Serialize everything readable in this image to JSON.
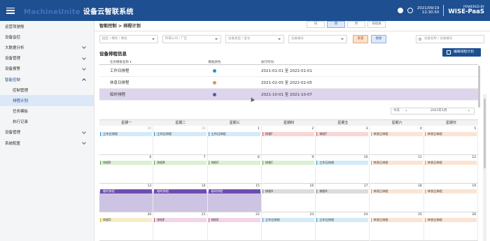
{
  "header": {
    "brand_en": "MachineUnite",
    "brand_cn": "设备云智联系统",
    "date": "2021/09/19",
    "time": "12:30:50",
    "powered_by": "POWERED BY",
    "platform": "WISE-PaaS"
  },
  "sidebar": {
    "items": [
      {
        "label": "运营驾驶舱"
      },
      {
        "label": "设备监控"
      },
      {
        "label": "大数据分析"
      },
      {
        "label": "设备管理"
      },
      {
        "label": "设备报警"
      },
      {
        "label": "智能控制"
      },
      {
        "label": "控制管理"
      },
      {
        "label": "排程计划"
      },
      {
        "label": "任务模板"
      },
      {
        "label": "执行记录"
      },
      {
        "label": "设备管理"
      },
      {
        "label": "系统配置"
      }
    ]
  },
  "breadcrumb": "智能控制 > 排程计划",
  "filters": {
    "area": "园区 / 楼栋 / 楼层",
    "company": "所属公司 / 厂区",
    "type": "设备类型 / 型号",
    "device": "设备编号",
    "reset": "重置",
    "search": "搜索",
    "search_placeholder": "设备名称 / 设备编号"
  },
  "section": {
    "title": "设备排程信息",
    "edit_button": "编辑排程计划"
  },
  "table": {
    "headers": [
      "任务模板名称 ▾",
      "模板颜色",
      "执行时间"
    ],
    "rows": [
      {
        "name": "工作日排程",
        "color": "#2a8fd0",
        "time": "2021-01-01 至 2022-01-01"
      },
      {
        "name": "休息日排程",
        "color": "#e8914f",
        "time": "2021-02-05 至 2022-02-05"
      },
      {
        "name": "临时排程",
        "color": "#6c4eb0",
        "time": "2021-10-01 至 2021-10-07"
      }
    ]
  },
  "views": {
    "day": "日",
    "week": "周",
    "month": "月",
    "agenda": "日程表",
    "today": "今天",
    "current": "2021年1月"
  },
  "calendar": {
    "weekdays": [
      "星期一",
      "星期二",
      "星期三",
      "星期四",
      "星期五",
      "星期六",
      "星期日"
    ],
    "weeks": [
      [
        {
          "d": "29",
          "other": true,
          "ev": "工作日排程"
        },
        {
          "d": "30",
          "other": true,
          "ev": "工作日排程"
        },
        {
          "d": "1",
          "ev": "工作日排程"
        },
        {
          "d": "2",
          "ev": "排程F"
        },
        {
          "d": "3",
          "ev": "排程F"
        },
        {
          "d": "4",
          "ev": "休息日排程"
        },
        {
          "d": "5",
          "ev": "休息日排程"
        }
      ],
      [
        {
          "d": "6",
          "ev": "排程B"
        },
        {
          "d": "7",
          "ev": "排程B"
        },
        {
          "d": "8",
          "ev": "排程C"
        },
        {
          "d": "9",
          "ev": "排程C"
        },
        {
          "d": "10",
          "ev": "工作日排程"
        },
        {
          "d": "11",
          "ev": "休息日排程"
        },
        {
          "d": "12",
          "ev": "休息日排程"
        }
      ],
      [
        {
          "d": "13",
          "ev": "临时排程"
        },
        {
          "d": "14",
          "ev": "临时排程"
        },
        {
          "d": "15",
          "ev": "临时排程"
        },
        {
          "d": "16",
          "ev": "排程A"
        },
        {
          "d": "17",
          "ev": "排程A"
        },
        {
          "d": "18",
          "ev": "休息日排程"
        },
        {
          "d": "19",
          "ev": "休息日排程"
        }
      ],
      [
        {
          "d": "20",
          "ev": "排程D"
        },
        {
          "d": "21",
          "ev": "排程E"
        },
        {
          "d": "22",
          "ev": "排程E"
        },
        {
          "d": "23",
          "ev": "工作日排程"
        },
        {
          "d": "24",
          "ev": "工作日排程"
        },
        {
          "d": "25",
          "ev": "休息日排程"
        },
        {
          "d": "26",
          "ev": "休息日排程"
        }
      ]
    ]
  },
  "colors": {
    "primary": "#1d4f91",
    "work": "#2a8fd0",
    "rest": "#e8914f",
    "temp": "#6c4eb0"
  }
}
